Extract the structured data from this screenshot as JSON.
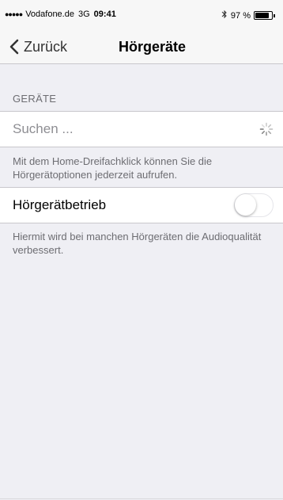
{
  "status_bar": {
    "signal": "●●●●●",
    "carrier": "Vodafone.de",
    "network": "3G",
    "time": "09:41",
    "bluetooth_icon": "bluetooth-icon",
    "battery_percent": "97 %",
    "battery_level": 0.97
  },
  "nav": {
    "back_label": "Zurück",
    "back_icon": "chevron-left-icon",
    "title": "Hörgeräte"
  },
  "devices_section": {
    "header": "GERÄTE",
    "search_label": "Suchen ...",
    "search_icon": "activity-spinner-icon",
    "footer": "Mit dem Home-Dreifachklick können Sie die Hörgerätoptionen jederzeit aufrufen."
  },
  "mode_section": {
    "label": "Hörgerätbetrieb",
    "toggle_on": false,
    "footer": "Hiermit wird bei manchen Hörgeräten die Audioqualität verbessert."
  },
  "colors": {
    "background": "#efeff4",
    "cell": "#ffffff",
    "secondary_text": "#6d6d72",
    "placeholder_text": "#8e8e93"
  }
}
